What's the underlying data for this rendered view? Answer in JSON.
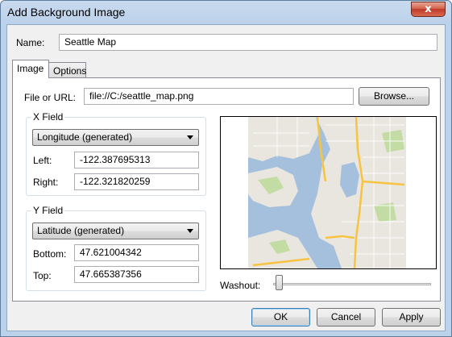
{
  "window": {
    "title": "Add Background Image",
    "close_glyph": "x"
  },
  "name_field": {
    "label": "Name:",
    "value": "Seattle Map"
  },
  "tabs": [
    {
      "label": "Image"
    },
    {
      "label": "Options"
    }
  ],
  "file": {
    "label": "File or URL:",
    "value": "file://C:/seattle_map.png",
    "browse_label": "Browse..."
  },
  "x_field": {
    "title": "X Field",
    "selected": "Longitude (generated)",
    "left_label": "Left:",
    "left_value": "-122.387695313",
    "right_label": "Right:",
    "right_value": "-122.321820259"
  },
  "y_field": {
    "title": "Y Field",
    "selected": "Latitude (generated)",
    "bottom_label": "Bottom:",
    "bottom_value": "47.621004342",
    "top_label": "Top:",
    "top_value": "47.665387356"
  },
  "washout": {
    "label": "Washout:",
    "value": 0
  },
  "buttons": {
    "ok": "OK",
    "cancel": "Cancel",
    "apply": "Apply"
  },
  "map": {
    "water": "#a4c0dc",
    "land": "#e9e6df",
    "park": "#c2dca4",
    "highway": "#f7c442",
    "road": "#ffffff"
  }
}
